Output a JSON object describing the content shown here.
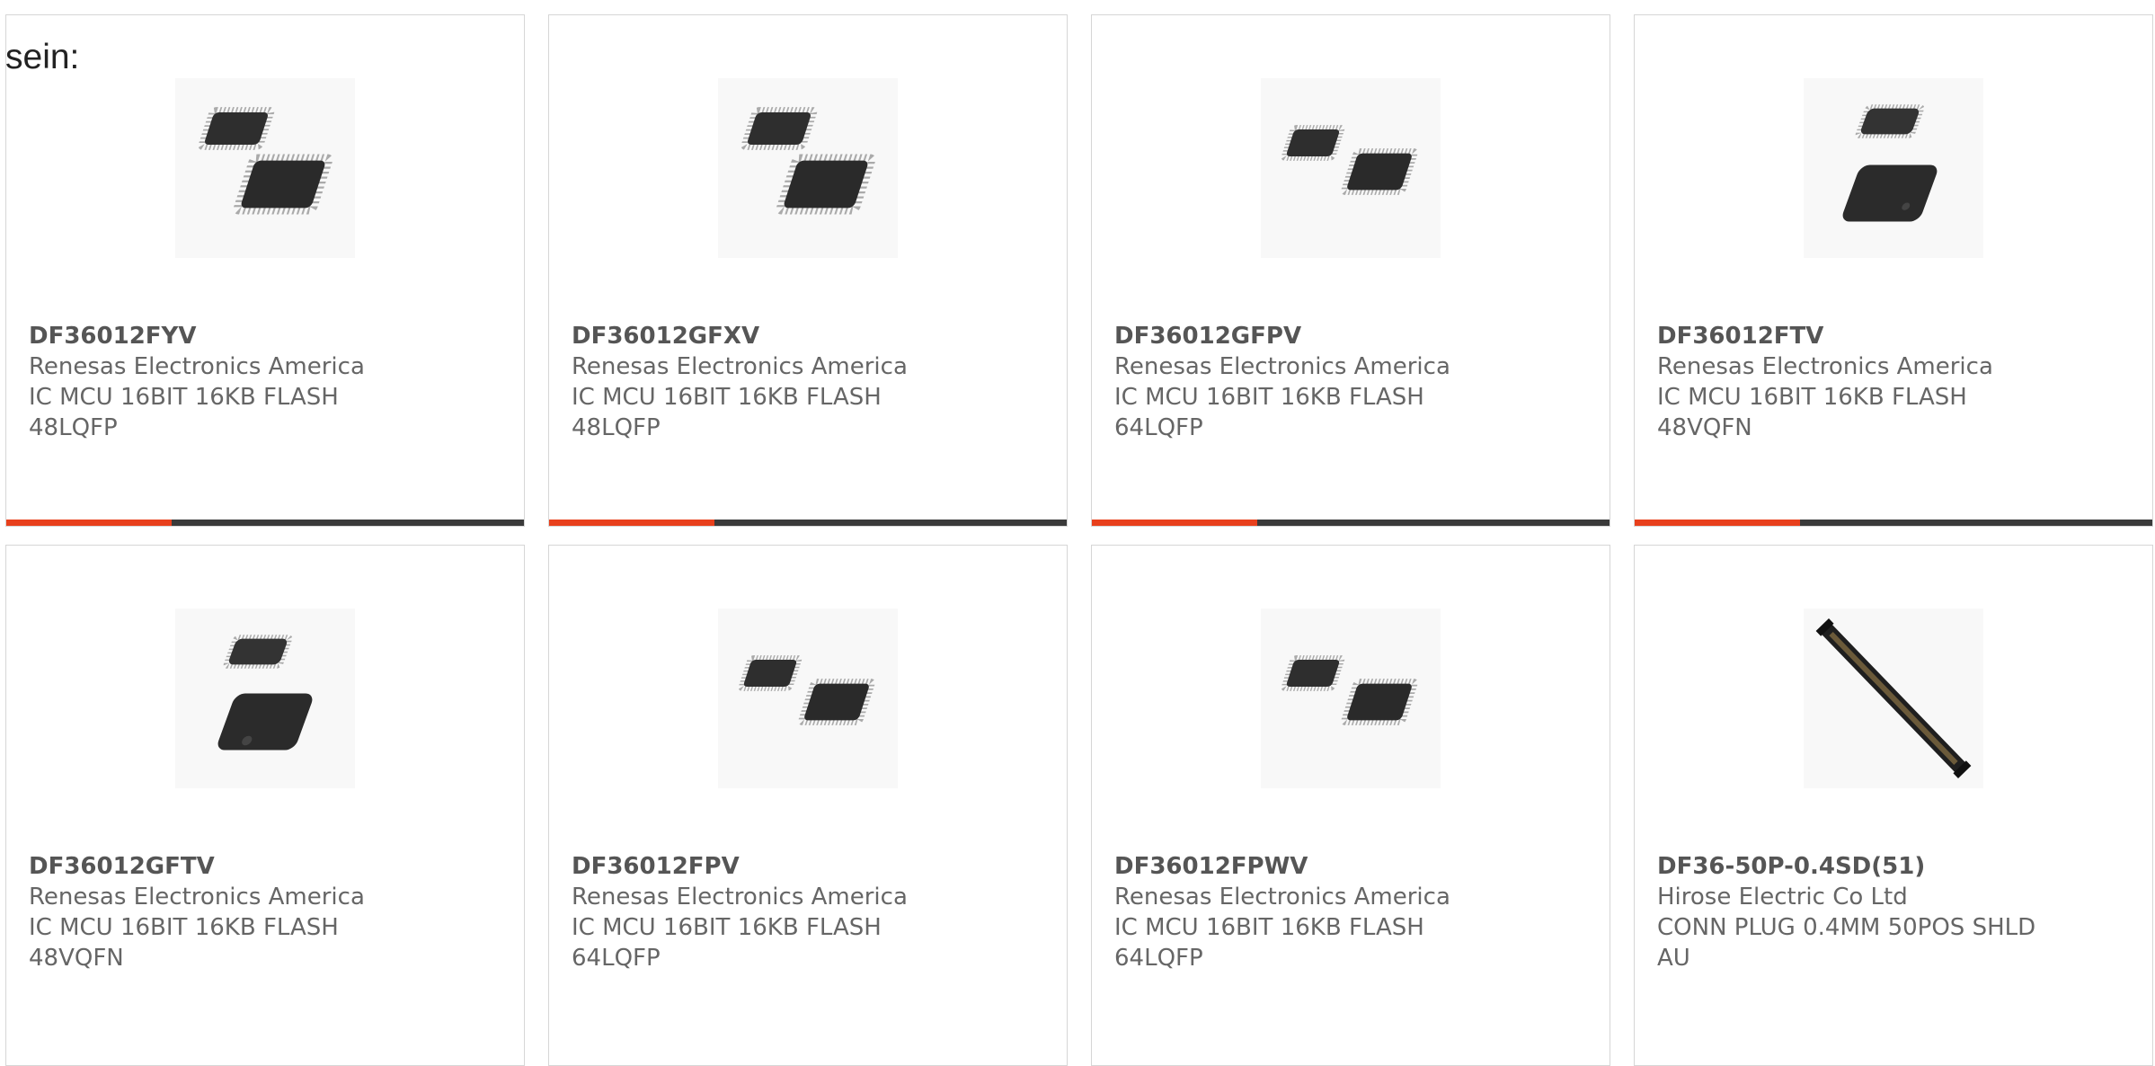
{
  "intro_text": "sein:",
  "colors": {
    "accent": "#e8401c",
    "bar_track": "#3a3a3a",
    "border": "#d6d6d6",
    "text": "#666666"
  },
  "products": [
    {
      "part_number": "DF36012FYV",
      "manufacturer": "Renesas Electronics America",
      "description": "IC MCU 16BIT 16KB FLASH 48LQFP",
      "image_icon": "two-qfp-chips-icon",
      "progress": 0.32
    },
    {
      "part_number": "DF36012GFXV",
      "manufacturer": "Renesas Electronics America",
      "description": "IC MCU 16BIT 16KB FLASH 48LQFP",
      "image_icon": "two-qfp-chips-icon",
      "progress": 0.32
    },
    {
      "part_number": "DF36012GFPV",
      "manufacturer": "Renesas Electronics America",
      "description": "IC MCU 16BIT 16KB FLASH 64LQFP",
      "image_icon": "two-qfp-chips-icon",
      "progress": 0.32
    },
    {
      "part_number": "DF36012FTV",
      "manufacturer": "Renesas Electronics America",
      "description": "IC MCU 16BIT 16KB FLASH 48VQFN",
      "image_icon": "qfn-chips-icon",
      "progress": 0.32
    },
    {
      "part_number": "DF36012GFTV",
      "manufacturer": "Renesas Electronics America",
      "description": "IC MCU 16BIT 16KB FLASH 48VQFN",
      "image_icon": "qfn-chips-icon"
    },
    {
      "part_number": "DF36012FPV",
      "manufacturer": "Renesas Electronics America",
      "description": "IC MCU 16BIT 16KB FLASH 64LQFP",
      "image_icon": "two-qfp-chips-icon"
    },
    {
      "part_number": "DF36012FPWV",
      "manufacturer": "Renesas Electronics America",
      "description": "IC MCU 16BIT 16KB FLASH 64LQFP",
      "image_icon": "two-qfp-chips-icon"
    },
    {
      "part_number": "DF36-50P-0.4SD(51)",
      "manufacturer": "Hirose Electric Co Ltd",
      "description": "CONN PLUG 0.4MM 50POS SHLD AU",
      "image_icon": "connector-plug-icon"
    }
  ]
}
